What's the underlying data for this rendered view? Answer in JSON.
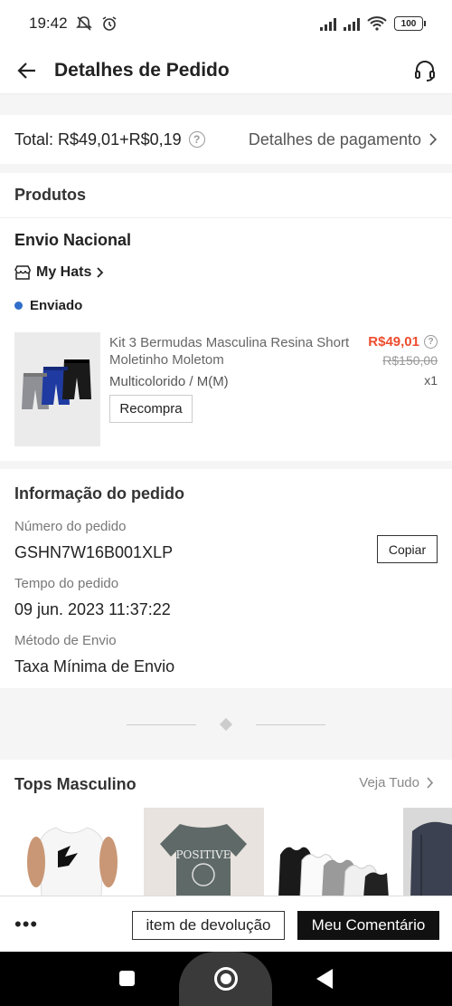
{
  "status_bar": {
    "time": "19:42",
    "battery": "100"
  },
  "header": {
    "title": "Detalhes de Pedido"
  },
  "total": {
    "label": "Total: R$49,01+R$0,19",
    "payment_link": "Detalhes de pagamento"
  },
  "products": {
    "section_title": "Produtos",
    "shipping_type": "Envio Nacional",
    "shop_name": "My Hats",
    "status": "Enviado",
    "item": {
      "name": "Kit 3 Bermudas Masculina Resina Short Moletinho Moletom",
      "variant": "Multicolorido / M(M)",
      "price": "R$49,01",
      "original_price": "R$150,00",
      "quantity": "x1",
      "rebuy_label": "Recompra"
    }
  },
  "order_info": {
    "section_title": "Informação do pedido",
    "order_number_label": "Número do pedido",
    "order_number": "GSHN7W16B001XLP",
    "copy_label": "Copiar",
    "order_time_label": "Tempo do pedido",
    "order_time": "09 jun. 2023 11:37:22",
    "shipping_method_label": "Método de Envio",
    "shipping_method": "Taxa Mínima de Envio"
  },
  "recommendations": {
    "title": "Tops Masculino",
    "see_all": "Veja Tudo",
    "card2_text": "POSITIVE"
  },
  "actions": {
    "more": "•••",
    "return_label": "item de devolução",
    "review_label": "Meu Comentário"
  },
  "colors": {
    "accent": "#ee4d2d",
    "status_dot": "#2f6fc9",
    "dark_button": "#111111"
  }
}
